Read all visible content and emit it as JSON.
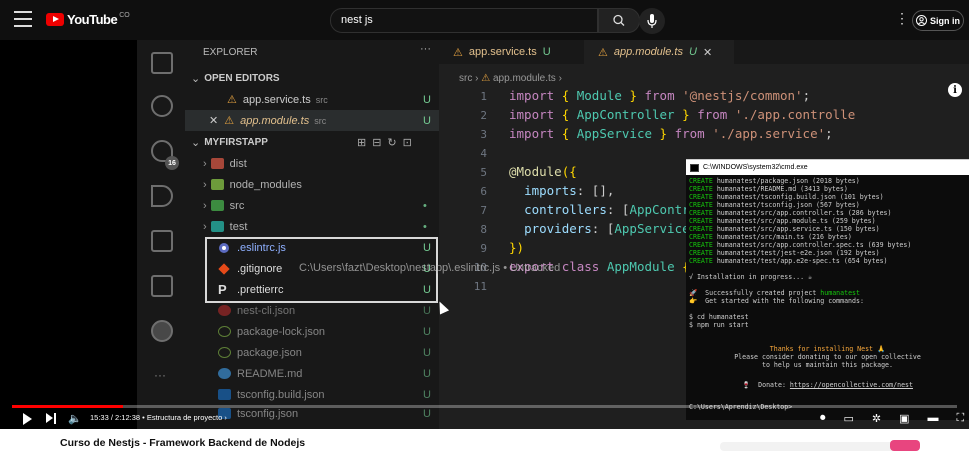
{
  "youtube": {
    "logo_text": "YouTube",
    "country": "CO",
    "search_value": "nest js",
    "signin_label": "Sign in",
    "video_title": "Curso de Nestjs - Framework Backend de Nodejs",
    "time": "15:33 / 2:12:38",
    "chapter": "• Estructura de proyecto ›",
    "progress_fraction": 0.117
  },
  "vscode": {
    "explorer_title": "EXPLORER",
    "explorer_more": "···",
    "open_editors_label": "OPEN EDITORS",
    "project_label": "MYFIRSTAPP",
    "scm_badge": "16",
    "open_editors": [
      {
        "name": "app.service.ts",
        "dir": "src",
        "status": "U"
      },
      {
        "name": "app.module.ts",
        "dir": "src",
        "status": "U"
      }
    ],
    "tree": [
      {
        "name": "dist",
        "status": ""
      },
      {
        "name": "node_modules",
        "status": ""
      },
      {
        "name": "src",
        "status": "•"
      },
      {
        "name": "test",
        "status": "•"
      },
      {
        "name": ".eslintrc.js",
        "status": "U"
      },
      {
        "name": ".gitignore",
        "status": "U"
      },
      {
        "name": ".prettierrc",
        "status": "U"
      },
      {
        "name": "nest-cli.json",
        "status": "U"
      },
      {
        "name": "package-lock.json",
        "status": "U"
      },
      {
        "name": "package.json",
        "status": "U"
      },
      {
        "name": "README.md",
        "status": "U"
      },
      {
        "name": "tsconfig.build.json",
        "status": "U"
      },
      {
        "name": "tsconfig.json",
        "status": "U"
      }
    ],
    "tabs": [
      {
        "label": "app.service.ts",
        "status": "U"
      },
      {
        "label": "app.module.ts",
        "status": "U"
      }
    ],
    "breadcrumb_dir": "src",
    "breadcrumb_file": "app.module.ts",
    "ghost_path": "C:\\Users\\fazt\\Desktop\\nestapp\\.eslintrc.js • Untracked",
    "line_numbers": [
      "1",
      "2",
      "3",
      "4",
      "5",
      "6",
      "7",
      "8",
      "9",
      "10",
      "11"
    ]
  },
  "cmd": {
    "title": "C:\\WINDOWS\\system32\\cmd.exe",
    "created_files": [
      "humanatest/package.json (2018 bytes)",
      "humanatest/README.md (3413 bytes)",
      "humanatest/tsconfig.build.json (101 bytes)",
      "humanatest/tsconfig.json (567 bytes)",
      "humanatest/src/app.controller.ts (286 bytes)",
      "humanatest/src/app.module.ts (259 bytes)",
      "humanatest/src/app.service.ts (150 bytes)",
      "humanatest/src/main.ts (216 bytes)",
      "humanatest/src/app.controller.spec.ts (639 bytes)",
      "humanatest/test/jest-e2e.json (192 bytes)",
      "humanatest/test/app.e2e-spec.ts (654 bytes)"
    ],
    "create_word": "CREATE",
    "installing": "√ Installation in progress... ☕",
    "success_prefix": "🚀  Successfully created project ",
    "project_name": "humanatest",
    "get_started": "👉  Get started with the following commands:",
    "cmd1": "$ cd humanatest",
    "cmd2": "$ npm run start",
    "thanks": "Thanks for installing Nest 🙏",
    "donate1": "Please consider donating to our open collective",
    "donate2": "to help us maintain this package.",
    "donate_label": "🍷  Donate: ",
    "donate_url": "https://opencollective.com/nest",
    "prompt": "C:\\Users\\Aprendiz\\Desktop>"
  }
}
